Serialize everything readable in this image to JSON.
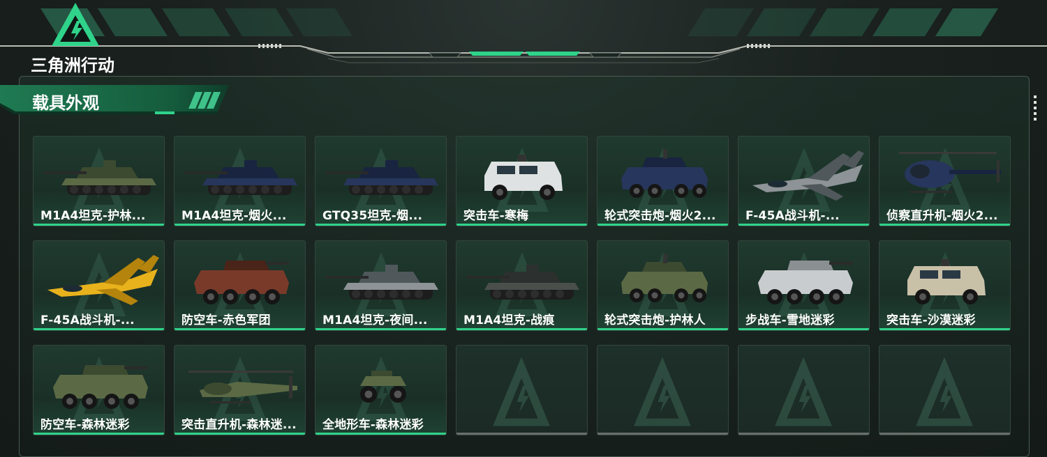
{
  "header": {
    "brand": "三角洲行动",
    "brand_icon": "delta-triangle-logo-icon",
    "accent_color": "#2fd38a"
  },
  "section": {
    "title": "载具外观"
  },
  "vehicles": [
    {
      "label": "M1A4坦克-护林...",
      "kind": "tank",
      "camo": "forest"
    },
    {
      "label": "M1A4坦克-烟火...",
      "kind": "tank",
      "camo": "navy"
    },
    {
      "label": "GTQ35坦克-烟...",
      "kind": "tank",
      "camo": "navy"
    },
    {
      "label": "突击车-寒梅",
      "kind": "assault-car",
      "camo": "white"
    },
    {
      "label": "轮式突击炮-烟火2...",
      "kind": "armored-car",
      "camo": "navy"
    },
    {
      "label": "F-45A战斗机-...",
      "kind": "jet",
      "camo": "gray"
    },
    {
      "label": "侦察直升机-烟火2...",
      "kind": "helicopter",
      "camo": "navy"
    },
    {
      "label": "F-45A战斗机-...",
      "kind": "jet",
      "camo": "yellow"
    },
    {
      "label": "防空车-赤色军团",
      "kind": "apc",
      "camo": "red"
    },
    {
      "label": "M1A4坦克-夜间...",
      "kind": "tank",
      "camo": "gray"
    },
    {
      "label": "M1A4坦克-战痕",
      "kind": "tank",
      "camo": "dark"
    },
    {
      "label": "轮式突击炮-护林人",
      "kind": "armored-car",
      "camo": "forest"
    },
    {
      "label": "步战车-雪地迷彩",
      "kind": "apc",
      "camo": "snow"
    },
    {
      "label": "突击车-沙漠迷彩",
      "kind": "assault-car",
      "camo": "desert"
    },
    {
      "label": "防空车-森林迷彩",
      "kind": "apc",
      "camo": "forest"
    },
    {
      "label": "突击直升机-森林迷...",
      "kind": "attack-helicopter",
      "camo": "forest"
    },
    {
      "label": "全地形车-森林迷彩",
      "kind": "atv",
      "camo": "forest"
    }
  ],
  "empty_slots": 4,
  "camo_colors": {
    "forest": [
      "#5b6a45",
      "#3c4a30"
    ],
    "navy": [
      "#27365c",
      "#182440"
    ],
    "white": [
      "#dfe2e2",
      "#9aa0a0"
    ],
    "gray": [
      "#8d9396",
      "#50585c"
    ],
    "yellow": [
      "#e8b21c",
      "#b5840c"
    ],
    "red": [
      "#7a3a2a",
      "#4a2418"
    ],
    "dark": [
      "#4a4f4c",
      "#2c302e"
    ],
    "snow": [
      "#c9ccce",
      "#8a8f92"
    ],
    "desert": [
      "#c9c0a8",
      "#8f856c"
    ]
  }
}
